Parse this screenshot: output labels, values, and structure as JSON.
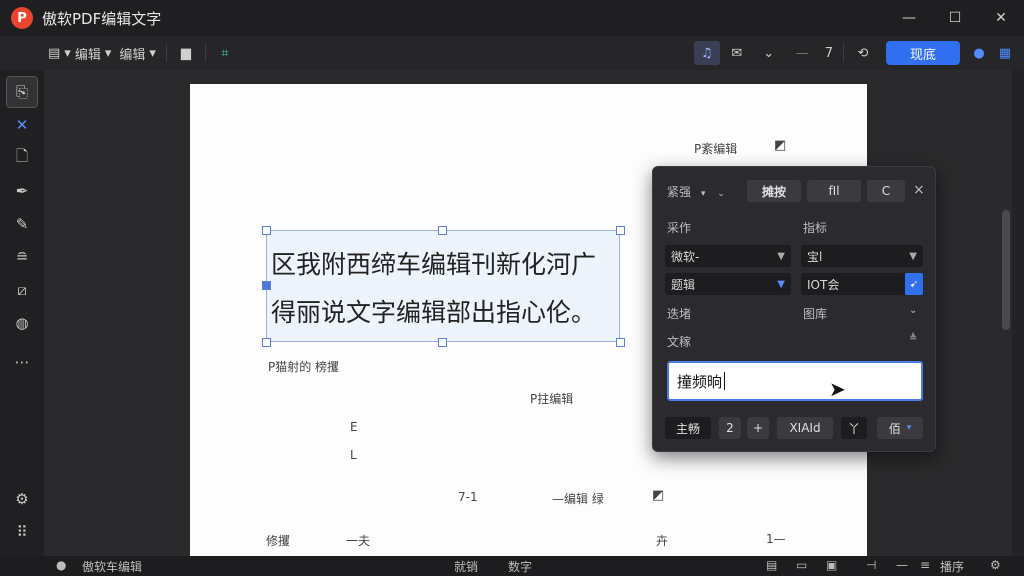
{
  "window": {
    "title": "傲软PDF编辑文字",
    "logo_letter": "P",
    "minimize": "—",
    "maximize": "☐",
    "close": "✕"
  },
  "toolbar": {
    "menu1": "编辑",
    "menu2": "编辑",
    "page_number": "7",
    "primary_button": "现底"
  },
  "page": {
    "label_top": "P紊编辑",
    "edit_line1": "区我附西缔车编辑刊新化河广",
    "edit_line2": "得丽说文字编辑部出指心伦。",
    "row_label": "P猫射的 榜攫",
    "mid_label": "P拄编辑",
    "letter1": "E",
    "letter2": "L",
    "range_label": "7-1",
    "range_label2": "—编辑 绿",
    "foot_left": "修攫",
    "foot_mid": "一夫",
    "foot_right": "卉",
    "foot_far": "1—"
  },
  "panel": {
    "header_select": "紧强",
    "btn_replace": "摊按",
    "btn_fill": "fIl",
    "btn_c": "C",
    "close": "×",
    "label_font": "采作",
    "label_size": "指标",
    "font_value": "微软-",
    "size_value": "宝l",
    "style_value": "题辑",
    "color_value": "IOT会",
    "label_align": "迭堵",
    "label_spacing": "图库",
    "label_text": "文稼",
    "input_value": "撞频晌",
    "btn_main": "主畅",
    "btn_two": "2",
    "btn_plus": "+",
    "btn_xiaid": "XIAId",
    "btn_y": "丫",
    "btn_last": "佰"
  },
  "status": {
    "left": "傲软车编辑",
    "center1": "就销",
    "center2": "数字",
    "right": "播序"
  },
  "colors": {
    "accent": "#2f6ff0",
    "brand": "#e8442e"
  }
}
